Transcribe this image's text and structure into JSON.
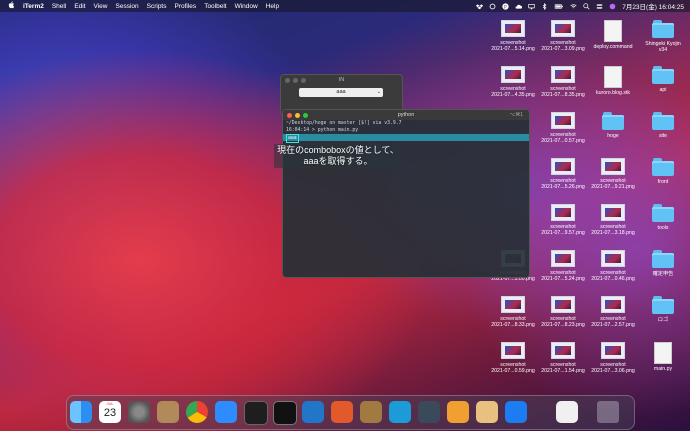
{
  "menubar": {
    "app_name": "iTerm2",
    "menus": [
      "Shell",
      "Edit",
      "View",
      "Session",
      "Scripts",
      "Profiles",
      "Toolbelt",
      "Window",
      "Help"
    ],
    "clock": "7月23日(金)  16:04:25"
  },
  "desktop_icons": [
    {
      "type": "screenshot",
      "l1": "screenshot",
      "l2": "2021-07...5.14.png"
    },
    {
      "type": "screenshot",
      "l1": "screenshot",
      "l2": "2021-07...3.09.png"
    },
    {
      "type": "doc",
      "l1": "deploy.command",
      "l2": ""
    },
    {
      "type": "folder",
      "l1": "Shingeki Kyojin",
      "l2": "v34"
    },
    {
      "type": "screenshot",
      "l1": "screenshot",
      "l2": "2021-07...4.35.png"
    },
    {
      "type": "screenshot",
      "l1": "screenshot",
      "l2": "2021-07...8.35.png"
    },
    {
      "type": "doc",
      "l1": "kuroro.blog.stk",
      "l2": ""
    },
    {
      "type": "folder",
      "l1": "api",
      "l2": ""
    },
    {
      "type": "screenshot",
      "l1": "screenshot",
      "l2": "2021-07...0.57.png"
    },
    {
      "type": "folder",
      "l1": "hoge",
      "l2": ""
    },
    {
      "type": "folder",
      "l1": "site",
      "l2": ""
    },
    {
      "type": "screenshot",
      "l1": "screenshot",
      "l2": "2021-07...5.26.png"
    },
    {
      "type": "screenshot",
      "l1": "screenshot",
      "l2": "2021-07...9.21.png"
    },
    {
      "type": "folder",
      "l1": "front",
      "l2": ""
    },
    {
      "type": "screenshot",
      "l1": "screenshot",
      "l2": "2021-07...9.57.png"
    },
    {
      "type": "screenshot",
      "l1": "screenshot",
      "l2": "2021-07...3.18.png"
    },
    {
      "type": "folder",
      "l1": "tools",
      "l2": ""
    },
    {
      "type": "screenshot",
      "l1": "screenshot",
      "l2": "2021-07...3.00.png"
    },
    {
      "type": "screenshot",
      "l1": "screenshot",
      "l2": "2021-07...5.24.png"
    },
    {
      "type": "screenshot",
      "l1": "screenshot",
      "l2": "2021-07...0.46.png"
    },
    {
      "type": "folder",
      "l1": "確定申告",
      "l2": ""
    },
    {
      "type": "screenshot",
      "l1": "screenshot",
      "l2": "2021-07...8.33.png"
    },
    {
      "type": "screenshot",
      "l1": "screenshot",
      "l2": "2021-07...8.23.png"
    },
    {
      "type": "screenshot",
      "l1": "screenshot",
      "l2": "2021-07...2.57.png"
    },
    {
      "type": "folder",
      "l1": "ロゴ",
      "l2": ""
    },
    {
      "type": "screenshot",
      "l1": "screenshot",
      "l2": "2021-07...0.59.png"
    },
    {
      "type": "screenshot",
      "l1": "screenshot",
      "l2": "2021-07...1.54.png"
    },
    {
      "type": "screenshot",
      "l1": "screenshot",
      "l2": "2021-07...3.06.png"
    },
    {
      "type": "doc",
      "l1": "main.py",
      "l2": ""
    }
  ],
  "in_window": {
    "title": "IN",
    "combobox_value": "aaa"
  },
  "term_window": {
    "title": "python",
    "shortcut": "⌥⌘1",
    "lines": [
      "~/Desktop/hoge on  master [$!] via  v3.9.7",
      "16:04:14 > python main.py",
      "aaa"
    ]
  },
  "caption": [
    "現在のcomboboxの値として、",
    "aaaを取得する。"
  ],
  "dock": {
    "calendar_month": "JUL",
    "calendar_day": "23",
    "apps": [
      "finder",
      "calendar",
      "system-preferences",
      "contacts",
      "chrome",
      "zoom",
      "terminal",
      "iterm",
      "vscode",
      "activity",
      "archive",
      "docker",
      "quicktime",
      "sourcetree",
      "preview",
      "infinity",
      "document",
      "trash"
    ]
  }
}
